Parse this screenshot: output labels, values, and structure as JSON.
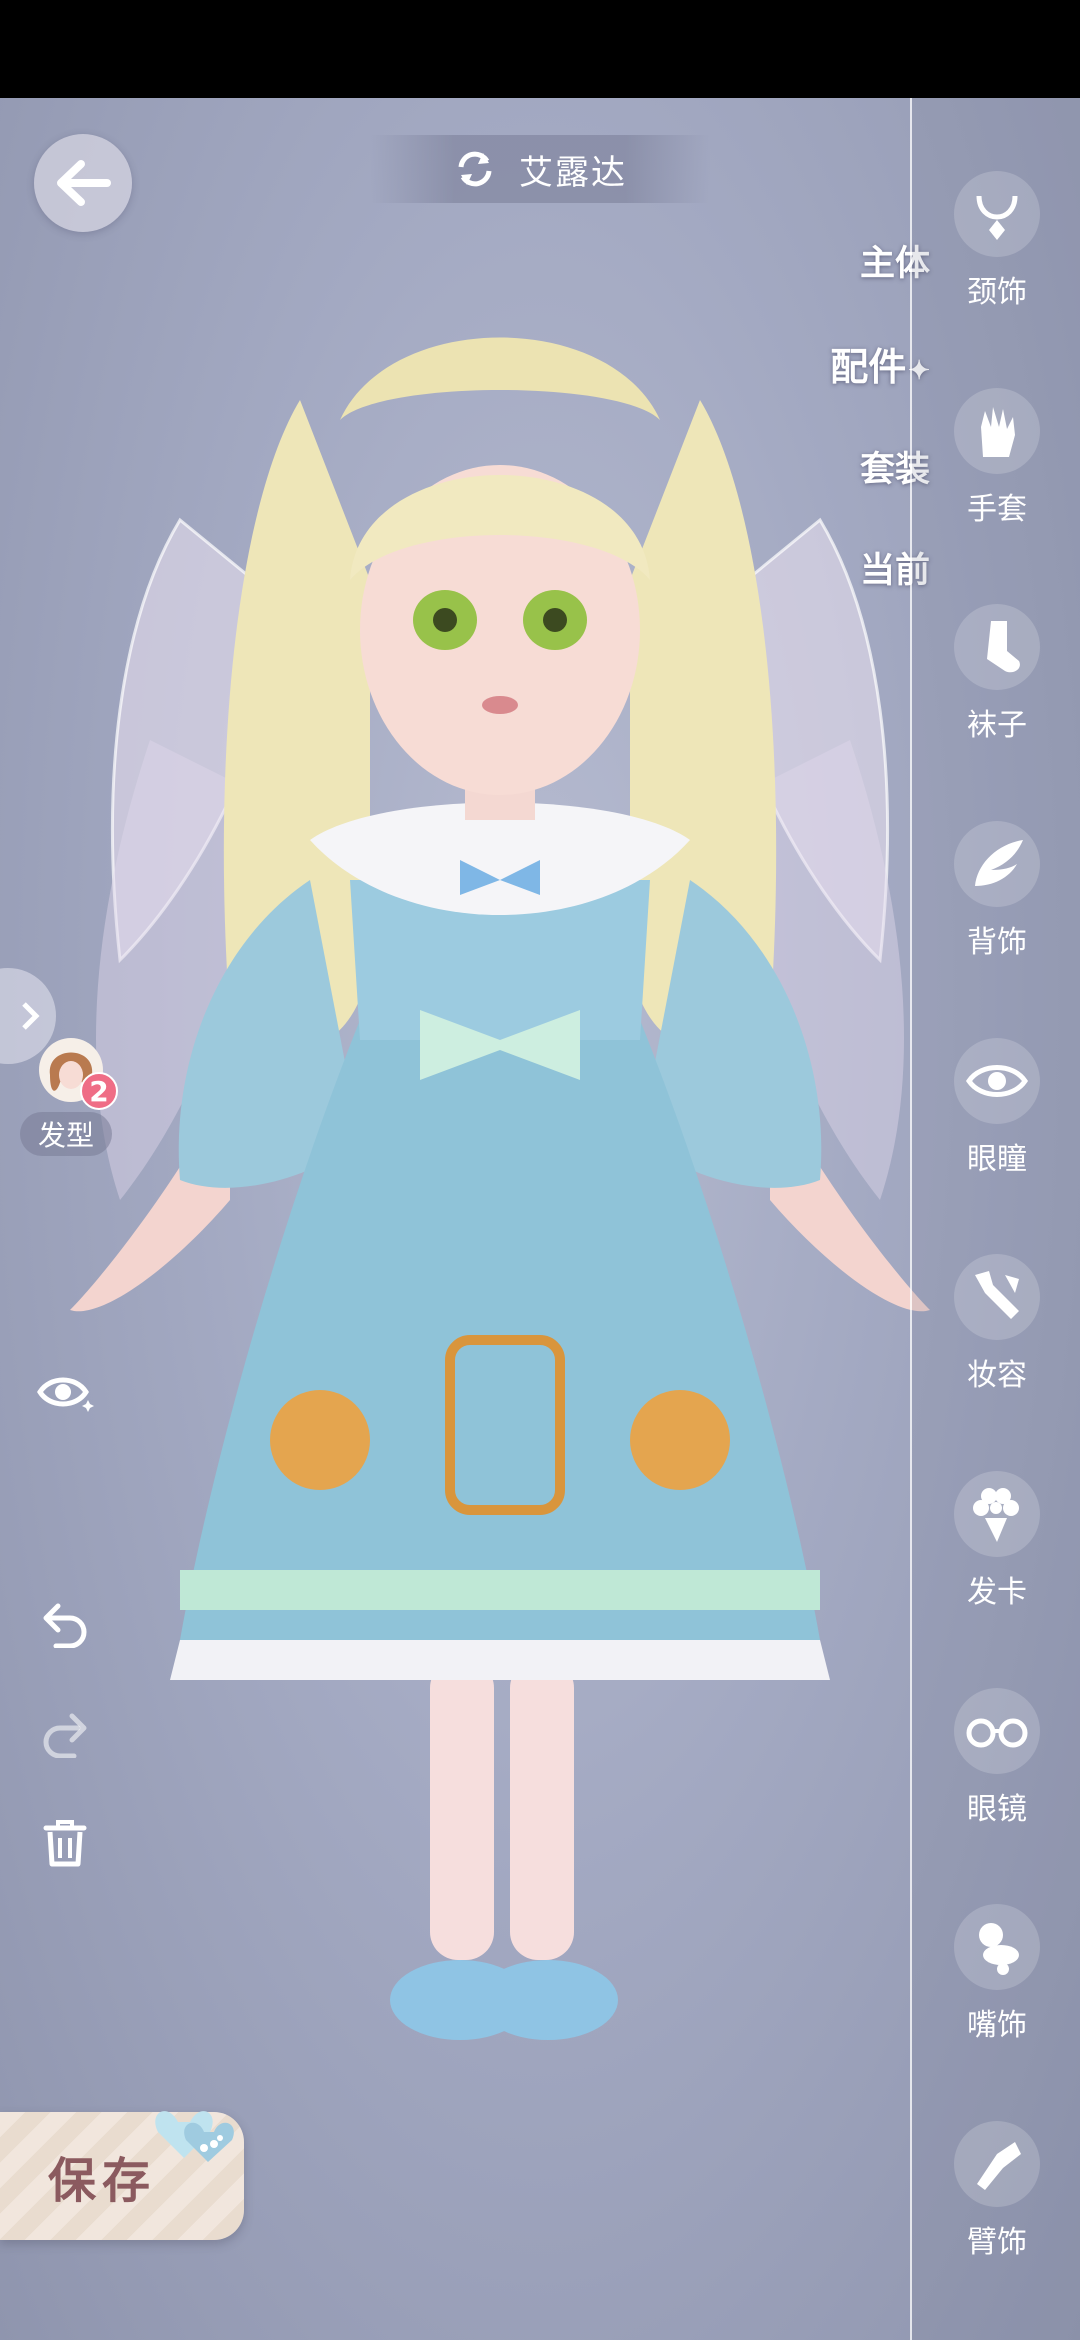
{
  "character_name": "艾露达",
  "category_tabs": [
    {
      "label": "主体",
      "active": false
    },
    {
      "label": "配件",
      "active": true
    },
    {
      "label": "套装",
      "active": false
    },
    {
      "label": "当前",
      "active": false
    }
  ],
  "right_panel": [
    {
      "label": "颈饰",
      "icon": "necklace-icon"
    },
    {
      "label": "手套",
      "icon": "glove-icon"
    },
    {
      "label": "袜子",
      "icon": "sock-icon"
    },
    {
      "label": "背饰",
      "icon": "wing-icon"
    },
    {
      "label": "眼瞳",
      "icon": "eye-icon"
    },
    {
      "label": "妆容",
      "icon": "makeup-brush-icon"
    },
    {
      "label": "发卡",
      "icon": "flower-hairpin-icon"
    },
    {
      "label": "眼镜",
      "icon": "glasses-icon"
    },
    {
      "label": "嘴饰",
      "icon": "pacifier-icon"
    },
    {
      "label": "臂饰",
      "icon": "armband-icon"
    }
  ],
  "left_panel": {
    "hair_label": "发型",
    "hair_badge": "2"
  },
  "save_label": "保存",
  "colors": {
    "accent_pink": "#ef6d86",
    "save_text": "#8b5a5f",
    "dress_blue": "#8fc3d8"
  }
}
